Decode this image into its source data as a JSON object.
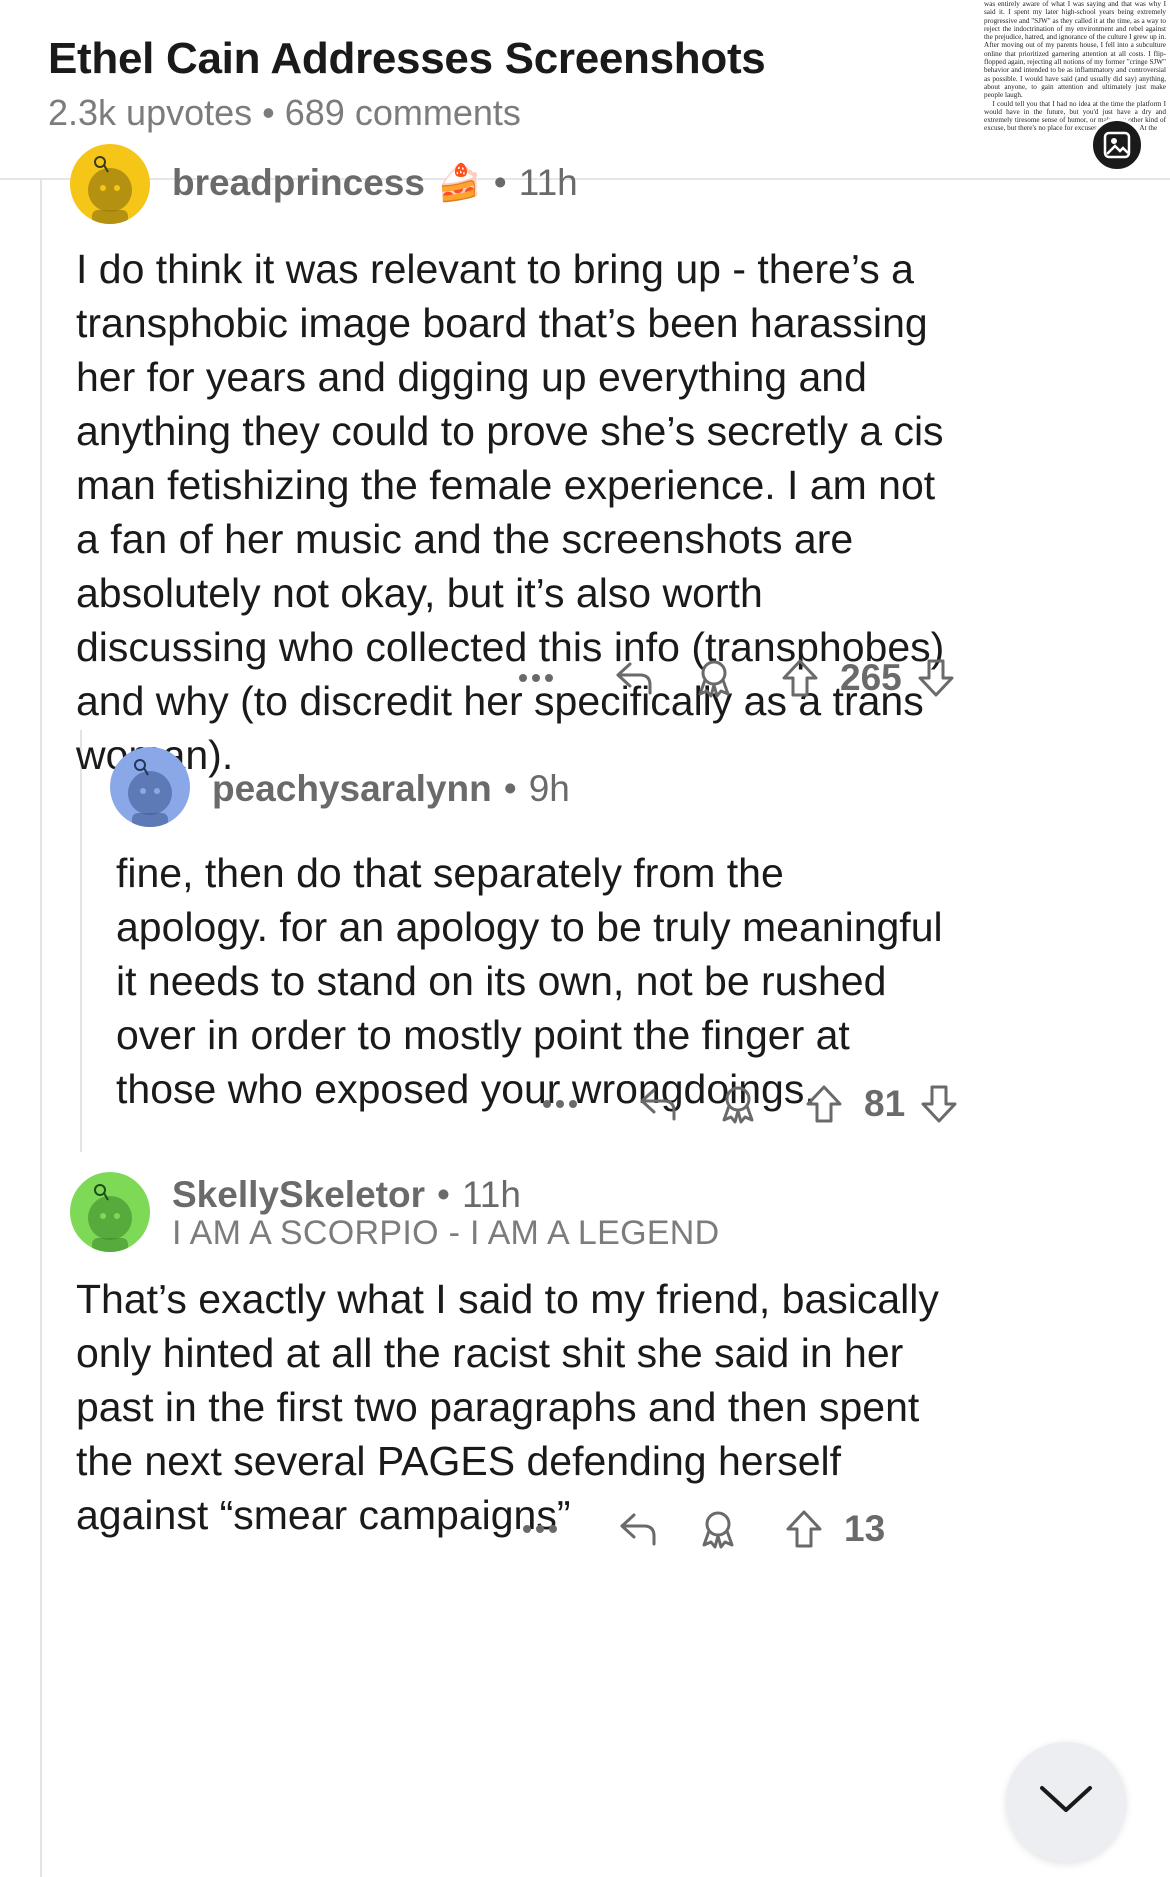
{
  "post": {
    "title": "Ethel Cain Addresses Screenshots",
    "upvotes": "2.3k upvotes",
    "separator": "•",
    "comments": "689 comments",
    "thumbnail_text": "was entirely aware of what I was saying and that was why I said it. I spent my later high-school years being extremely progressive and \"SJW\" as they called it at the time, as a way to reject the indoctrination of my environment and rebel against the prejudice, hatred, and ignorance of the culture I grew up in. After moving out of my parents house, I fell into a subculture online that prioritized garnering attention at all costs. I flip-flopped again, rejecting all notions of my former \"cringe SJW\" behavior and intended to be as inflammatory and controversial as possible. I would have said (and usually did say) anything, about anyone, to gain attention and ultimately just make people laugh.\n    I could tell you that I had no idea at the time the platform I would have in the future, but you'd just have a dry and extremely tiresome sense of humor, or make any other kind of excuse, but there's no place for excuses in this matter. At the"
  },
  "comments": [
    {
      "username": "breadprincess",
      "flair_emoji": "🍰",
      "separator": "•",
      "time": "11h",
      "body": "I do think it was relevant to bring up - there’s a transphobic image board that’s been harassing her for years and digging up everything and anything they could to prove she’s secretly a cis man fetishizing the female experience. I am not a fan of her music and the screenshots are absolutely not okay, but it’s also worth discussing who collected this info (transphobes) and why (to discredit her specifically as a trans woman).",
      "votes": "265",
      "avatar_color": "#f5c518"
    },
    {
      "username": "peachysaralynn",
      "separator": "•",
      "time": "9h",
      "body": "fine, then do that separately from the apology. for an apology to be truly meaningful it needs to stand on its own, not be rushed over in order to mostly point the finger at those who exposed your wrongdoings.",
      "votes": "81",
      "avatar_color": "#8aa8e8"
    },
    {
      "username": "SkellySkeletor",
      "separator": "•",
      "time": "11h",
      "flair": "I AM A SCORPIO - I AM A LEGEND",
      "body": "That’s exactly what I said to my friend, basically only hinted at all the racist shit she said in her past in the first two paragraphs and then spent the next several PAGES defending herself against “smear campaigns”",
      "votes": "13",
      "avatar_color": "#7ed957"
    }
  ],
  "icons": {
    "more": "more-icon",
    "reply": "reply-icon",
    "award": "award-icon",
    "upvote": "upvote-icon",
    "downvote": "downvote-icon",
    "scroll": "chevron-down-icon"
  },
  "colors": {
    "text": "#1a1a1b",
    "meta": "#7c7c7c",
    "thread_line": "#e3e3e3"
  }
}
